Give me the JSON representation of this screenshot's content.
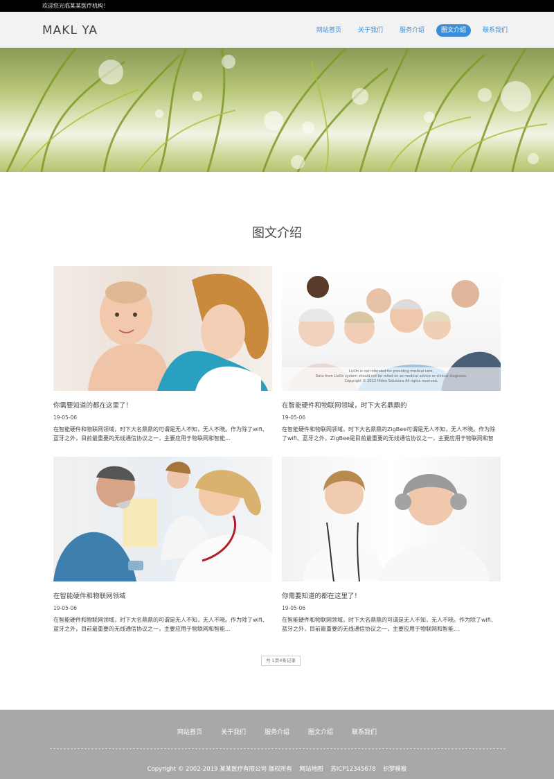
{
  "topbar": {
    "welcome": "欢迎您光临某某医疗机构！"
  },
  "header": {
    "logo": "MAKL YA",
    "nav": [
      {
        "label": "网站首页"
      },
      {
        "label": "关于我们"
      },
      {
        "label": "服务介绍"
      },
      {
        "label": "图文介绍",
        "active": true
      },
      {
        "label": "联系我们"
      }
    ]
  },
  "section": {
    "title": "图文介绍"
  },
  "cards": [
    {
      "title": "你需要知道的都在这里了！",
      "date": "19-05-06",
      "desc": "在智能硬件和物联网领域，时下大名鼎鼎的可谓是无人不知，无人不晓。作为除了wifi、蓝牙之外，目前最重要的无线通信协议之一，主要应用于物联网和智能...",
      "image": "mother-baby-photo"
    },
    {
      "title": "在智能硬件和物联网领域，时下大名鼎鼎的",
      "date": "19-05-06",
      "desc": "在智能硬件和物联网领域，时下大名鼎鼎的ZigBee可谓是无人不知，无人不晓。作为除了wifi、蓝牙之外，ZigBee是目前最重要的无线通信协议之一，主要应用于物联网和智",
      "image": "seniors-group-photo"
    },
    {
      "title": "在智能硬件和物联网领域",
      "date": "19-05-06",
      "desc": "在智能硬件和物联网领域，时下大名鼎鼎的可谓是无人不知，无人不晓。作为除了wifi、蓝牙之外，目前最重要的无线通信协议之一，主要应用于物联网和智能...",
      "image": "doctor-patient-photo"
    },
    {
      "title": "你需要知道的都在这里了！",
      "date": "19-05-06",
      "desc": "在智能硬件和物联网领域，时下大名鼎鼎的可谓是无人不知，无人不晓。作为除了wifi、蓝牙之外，目前最重要的无线通信协议之一，主要应用于物联网和智能...",
      "image": "nurse-elderly-photo"
    }
  ],
  "thumb_caption": {
    "line1": "LivOn is not intended for providing medical care.",
    "line2": "Data from LivOn system should not be relied on as medical advice or clinical diagnosis.",
    "line3": "Copyright © 2013 Hidea Solutions All rights reserved."
  },
  "pager": {
    "text": "共 1页4条记录"
  },
  "footer": {
    "nav": [
      {
        "label": "网站首页"
      },
      {
        "label": "关于我们"
      },
      {
        "label": "服务介绍"
      },
      {
        "label": "图文介绍"
      },
      {
        "label": "联系我们"
      }
    ],
    "copyright": "Copyright © 2002-2019 某某医疗有限公司 版权所有",
    "sitemap": "网站地图",
    "icp": "苏ICP12345678",
    "template": "织梦模板"
  },
  "colors": {
    "accent": "#3a8ed8",
    "footer_bg": "#a8a8a8",
    "topbar_bg": "#000000"
  }
}
